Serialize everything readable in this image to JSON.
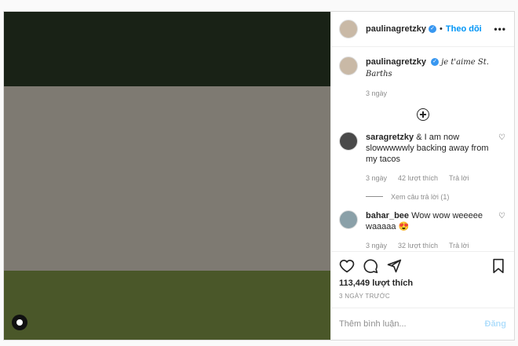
{
  "header": {
    "username": "paulinagretzky",
    "follow_label": "Theo dõi",
    "more_label": "•••"
  },
  "caption": {
    "username": "paulinagretzky",
    "text": "je t'aime St. Barths",
    "time": "3 ngày"
  },
  "comments": [
    {
      "username": "saragretzky",
      "text": "& I am now slowwwwwly backing away from my tacos",
      "time": "3 ngày",
      "likes": "42 lượt thích",
      "reply": "Trả lời",
      "view_replies": "Xem câu trả lời (1)"
    },
    {
      "username": "bahar_bee",
      "text": "Wow wow weeeee waaaaa 😍",
      "time": "3 ngày",
      "likes": "32 lượt thích",
      "reply": "Trả lời"
    }
  ],
  "actions": {
    "likes": "113,449 lượt thích",
    "date": "3 NGÀY TRƯỚC"
  },
  "add_comment": {
    "placeholder": "Thêm bình luận...",
    "post_label": "Đăng"
  },
  "colors": {
    "accent": "#0095f6",
    "verified": "#3897f0",
    "post_disabled": "#b2dffc"
  }
}
